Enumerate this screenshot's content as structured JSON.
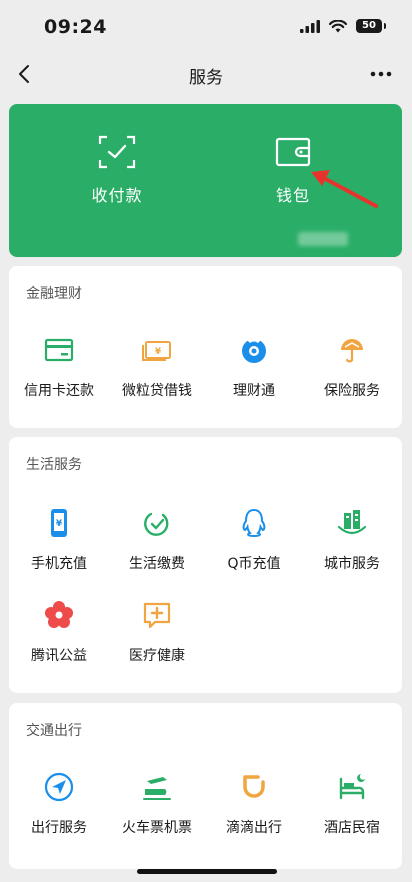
{
  "status_bar": {
    "time": "09:24",
    "battery": "50"
  },
  "nav": {
    "title": "服务",
    "back_icon": "chevron-left-icon",
    "more_icon": "more-dots-icon"
  },
  "hero": {
    "items": [
      {
        "label": "收付款",
        "icon": "scan-pay-icon"
      },
      {
        "label": "钱包",
        "icon": "wallet-icon"
      }
    ],
    "accent": "#2aae67"
  },
  "sections": [
    {
      "title": "金融理财",
      "items": [
        {
          "label": "信用卡还款",
          "icon": "credit-card-icon"
        },
        {
          "label": "微粒贷借钱",
          "icon": "loan-icon"
        },
        {
          "label": "理财通",
          "icon": "wealth-icon"
        },
        {
          "label": "保险服务",
          "icon": "insurance-icon"
        }
      ]
    },
    {
      "title": "生活服务",
      "items": [
        {
          "label": "手机充值",
          "icon": "phone-recharge-icon"
        },
        {
          "label": "生活缴费",
          "icon": "utility-bill-icon"
        },
        {
          "label": "Q币充值",
          "icon": "qq-coin-icon"
        },
        {
          "label": "城市服务",
          "icon": "city-service-icon"
        },
        {
          "label": "腾讯公益",
          "icon": "charity-icon"
        },
        {
          "label": "医疗健康",
          "icon": "medical-icon"
        }
      ]
    },
    {
      "title": "交通出行",
      "items": [
        {
          "label": "出行服务",
          "icon": "travel-icon"
        },
        {
          "label": "火车票机票",
          "icon": "train-plane-icon"
        },
        {
          "label": "滴滴出行",
          "icon": "didi-icon"
        },
        {
          "label": "酒店民宿",
          "icon": "hotel-icon"
        }
      ]
    }
  ]
}
